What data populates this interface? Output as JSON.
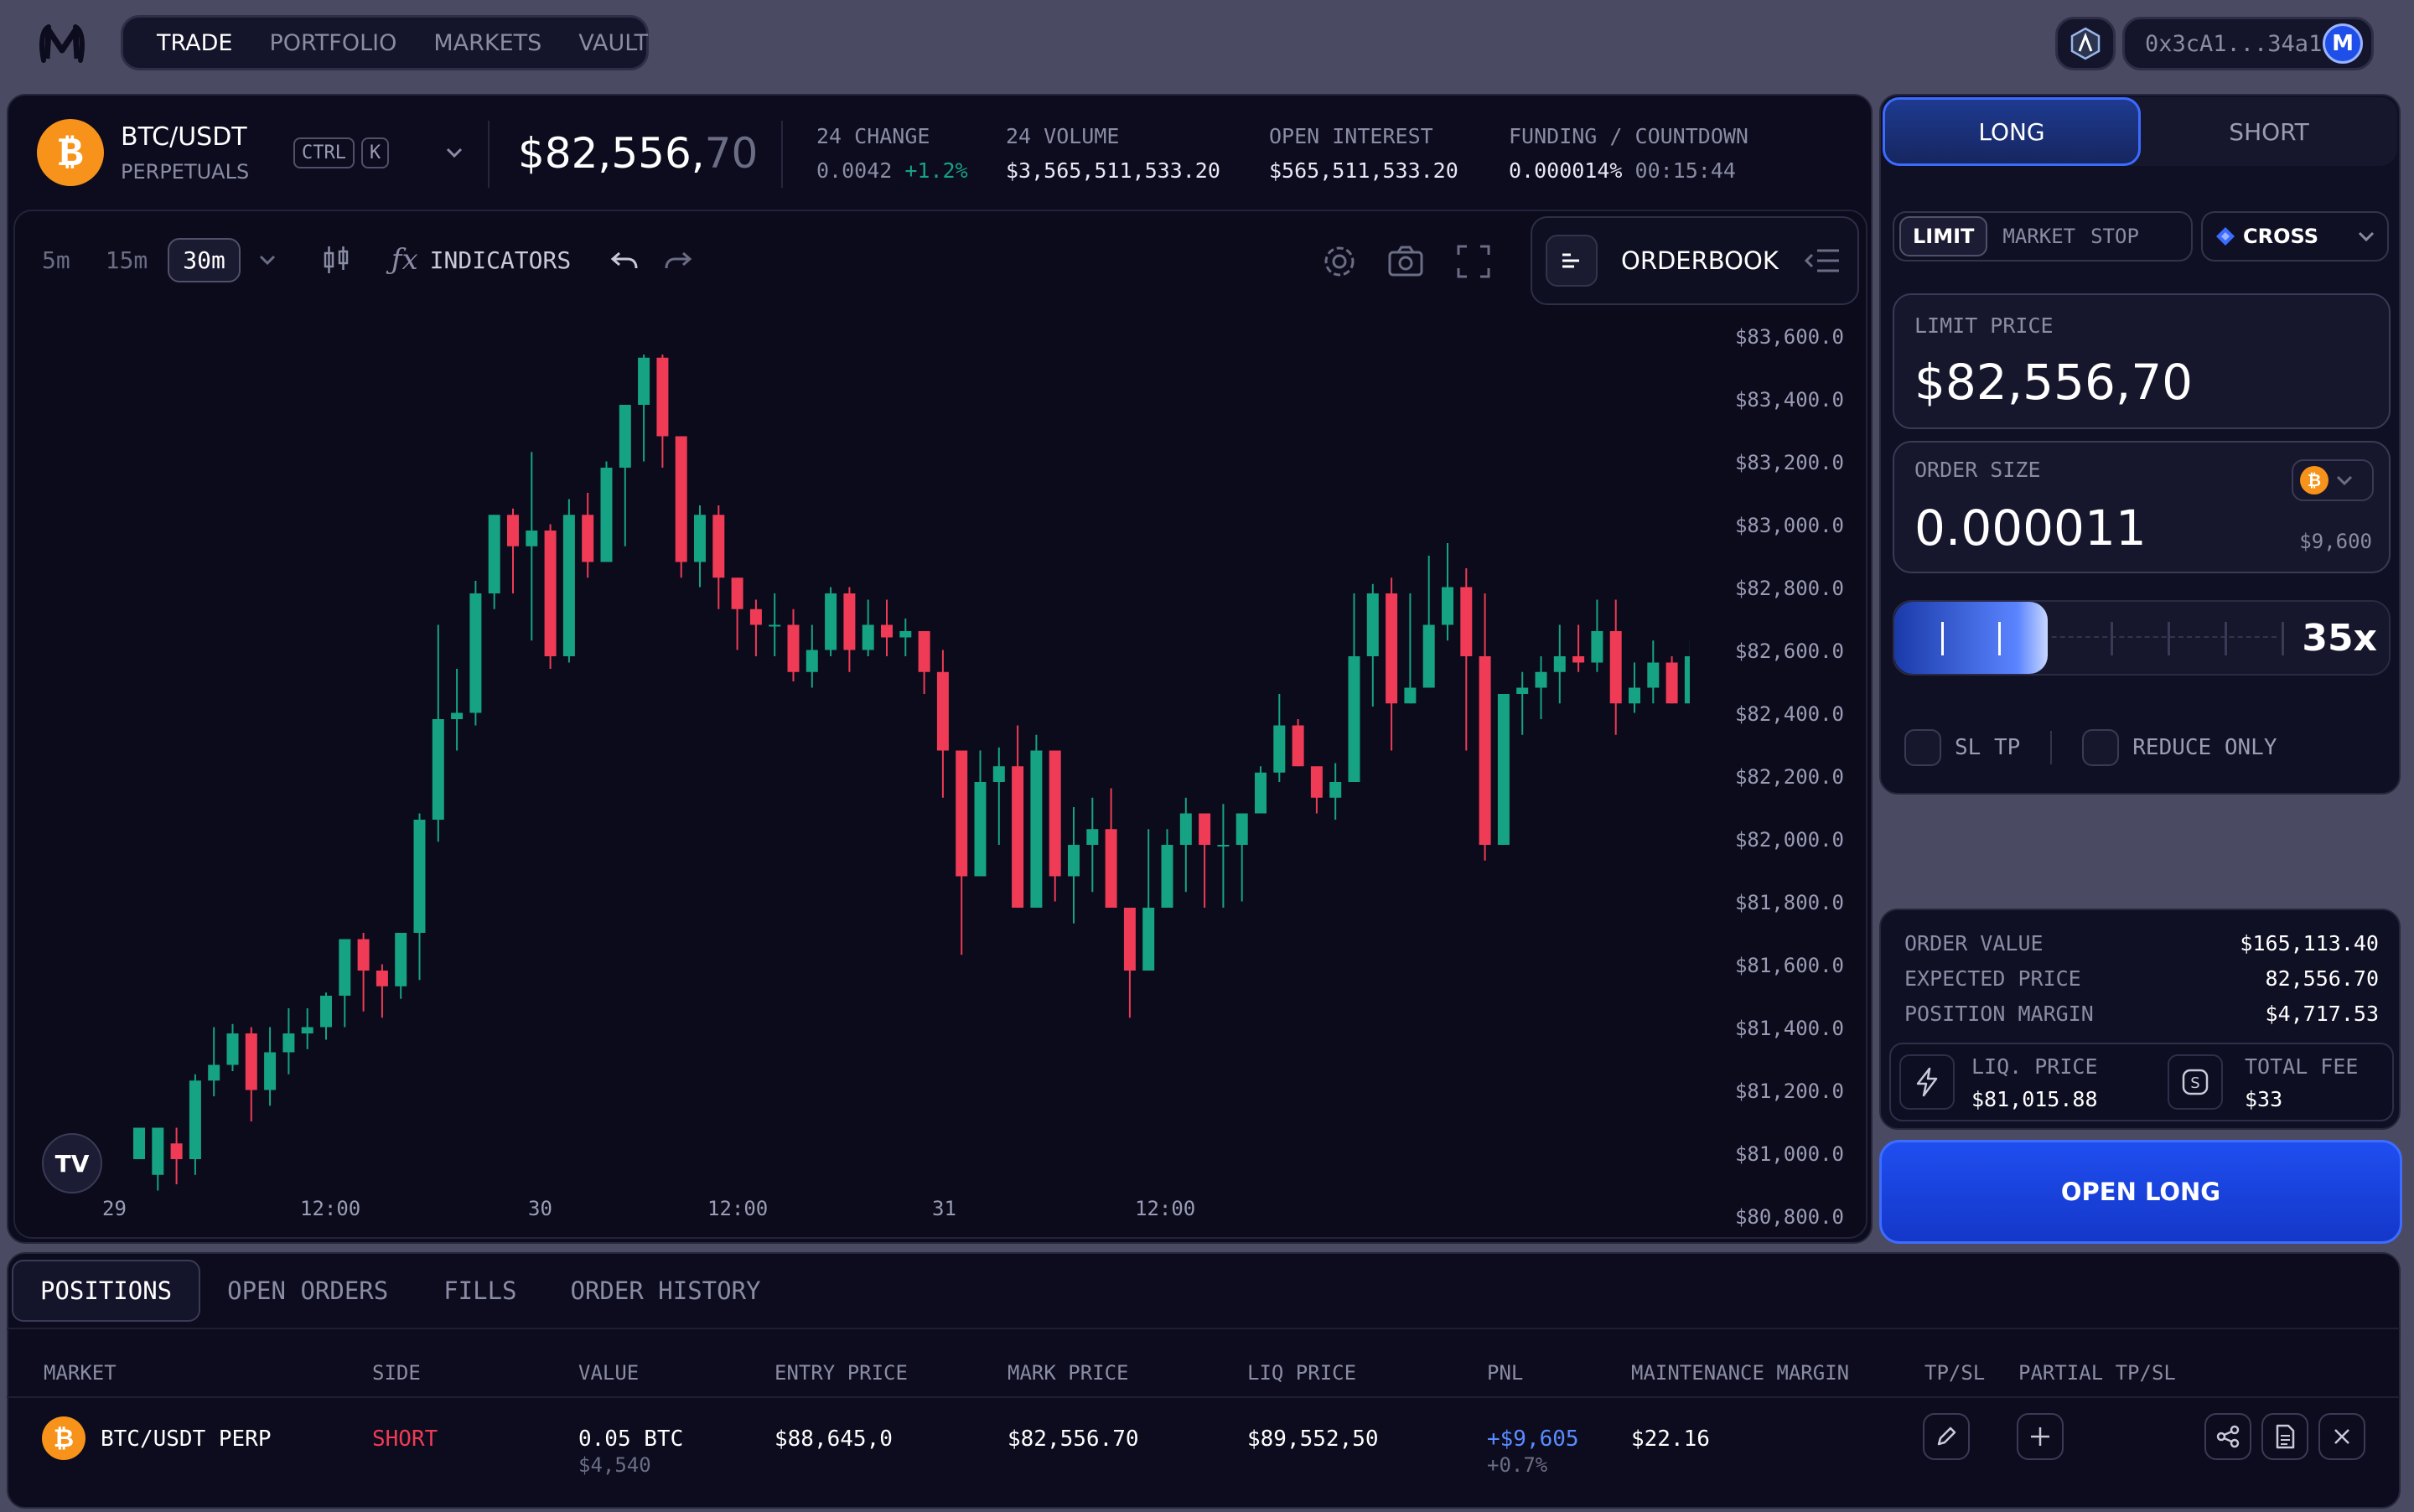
{
  "nav": {
    "tabs": [
      "TRADE",
      "PORTFOLIO",
      "MARKETS",
      "VAULT"
    ],
    "active_tab": "TRADE",
    "wallet_address": "0x3cA1...34a1"
  },
  "market": {
    "symbol": "BTC/USDT",
    "type": "PERPETUALS",
    "shortcut_keys": [
      "CTRL",
      "K"
    ],
    "price_main": "$82,556,",
    "price_decimals": "70",
    "stats": [
      {
        "label": "24 CHANGE",
        "value": "0.0042",
        "extra": "+1.2%"
      },
      {
        "label": "24 VOLUME",
        "value": "$3,565,511,533.20",
        "extra": ""
      },
      {
        "label": "OPEN INTEREST",
        "value": "$565,511,533.20",
        "extra": ""
      },
      {
        "label": "FUNDING / COUNTDOWN",
        "value": "0.000014%",
        "extra": "00:15:44"
      }
    ]
  },
  "chart_toolbar": {
    "timeframes": [
      "5m",
      "15m",
      "30m"
    ],
    "active_timeframe": "30m",
    "indicators_label": "INDICATORS",
    "orderbook_label": "ORDERBOOK"
  },
  "chart_data": {
    "type": "candlestick",
    "y_ticks": [
      "$83,600.0",
      "$83,400.0",
      "$83,200.0",
      "$83,000.0",
      "$82,800.0",
      "$82,600.0",
      "$82,400.0",
      "$82,200.0",
      "$82,000.0",
      "$81,800.0",
      "$81,600.0",
      "$81,400.0",
      "$81,200.0",
      "$81,000.0",
      "$80,800.0"
    ],
    "x_ticks": [
      "29",
      "12:00",
      "30",
      "12:00",
      "31",
      "12:00"
    ],
    "ylim": [
      80800,
      83600
    ],
    "colors": {
      "up": "#16a383",
      "down": "#ef3b55"
    },
    "candles": [
      [
        81000,
        81100,
        80950,
        80950
      ],
      [
        80950,
        81100,
        80900,
        81050
      ],
      [
        81050,
        81000,
        80920,
        81100
      ],
      [
        81000,
        81250,
        80950,
        81270
      ],
      [
        81250,
        81300,
        81200,
        81420
      ],
      [
        81300,
        81400,
        81280,
        81430
      ],
      [
        81400,
        81220,
        81120,
        81420
      ],
      [
        81220,
        81340,
        81170,
        81420
      ],
      [
        81340,
        81400,
        81270,
        81480
      ],
      [
        81400,
        81420,
        81350,
        81480
      ],
      [
        81420,
        81520,
        81380,
        81530
      ],
      [
        81520,
        81700,
        81420,
        81700
      ],
      [
        81700,
        81600,
        81470,
        81720
      ],
      [
        81600,
        81550,
        81450,
        81620
      ],
      [
        81550,
        81720,
        81510,
        81720
      ],
      [
        81720,
        82080,
        81570,
        82100
      ],
      [
        82080,
        82400,
        82010,
        82700
      ],
      [
        82400,
        82420,
        82300,
        82560
      ],
      [
        82420,
        82800,
        82380,
        82840
      ],
      [
        82800,
        83050,
        82750,
        83050
      ],
      [
        83050,
        82950,
        82800,
        83070
      ],
      [
        82950,
        83000,
        82650,
        83250
      ],
      [
        83000,
        82600,
        82560,
        83020
      ],
      [
        82600,
        83050,
        82580,
        83100
      ],
      [
        83050,
        82900,
        82850,
        83120
      ],
      [
        82900,
        83200,
        82900,
        83220
      ],
      [
        83200,
        83400,
        82950,
        83400
      ],
      [
        83400,
        83550,
        83220,
        83560
      ],
      [
        83550,
        83300,
        83200,
        83560
      ],
      [
        83300,
        82900,
        82850,
        83200
      ],
      [
        82900,
        83050,
        82820,
        83080
      ],
      [
        83050,
        82850,
        82750,
        83080
      ],
      [
        82850,
        82750,
        82620,
        82850
      ],
      [
        82750,
        82700,
        82600,
        82780
      ],
      [
        82700,
        82700,
        82600,
        82800
      ],
      [
        82700,
        82550,
        82520,
        82750
      ],
      [
        82550,
        82620,
        82500,
        82700
      ],
      [
        82620,
        82800,
        82600,
        82820
      ],
      [
        82800,
        82620,
        82550,
        82820
      ],
      [
        82620,
        82700,
        82600,
        82780
      ],
      [
        82700,
        82660,
        82600,
        82780
      ],
      [
        82660,
        82680,
        82600,
        82720
      ],
      [
        82680,
        82550,
        82480,
        82660
      ],
      [
        82550,
        82300,
        82150,
        82620
      ],
      [
        82300,
        81900,
        81650,
        82300
      ],
      [
        81900,
        82200,
        81900,
        82300
      ],
      [
        82200,
        82250,
        82000,
        82310
      ],
      [
        82250,
        81800,
        81800,
        82380
      ],
      [
        81800,
        82300,
        81880,
        82350
      ],
      [
        82300,
        81900,
        81820,
        82300
      ],
      [
        81900,
        82000,
        81750,
        82120
      ],
      [
        82000,
        82050,
        81850,
        82150
      ],
      [
        82050,
        81800,
        81800,
        82180
      ],
      [
        81800,
        81600,
        81450,
        81800
      ],
      [
        81600,
        81800,
        81750,
        82050
      ],
      [
        81800,
        82000,
        81800,
        82050
      ],
      [
        82000,
        82100,
        81850,
        82150
      ],
      [
        82100,
        82000,
        81800,
        82100
      ],
      [
        82000,
        82000,
        81800,
        82130
      ],
      [
        82000,
        82100,
        81820,
        82100
      ],
      [
        82100,
        82230,
        82100,
        82250
      ],
      [
        82230,
        82380,
        82200,
        82480
      ],
      [
        82380,
        82250,
        82250,
        82400
      ],
      [
        82250,
        82150,
        82100,
        82220
      ],
      [
        82150,
        82200,
        82080,
        82260
      ],
      [
        82200,
        82600,
        82200,
        82800
      ],
      [
        82600,
        82800,
        82440,
        82830
      ],
      [
        82800,
        82450,
        82300,
        82850
      ],
      [
        82450,
        82500,
        82450,
        82800
      ],
      [
        82500,
        82700,
        82650,
        82920
      ],
      [
        82700,
        82820,
        82650,
        82960
      ],
      [
        82820,
        82600,
        82300,
        82880
      ],
      [
        82600,
        82000,
        81950,
        82800
      ],
      [
        82000,
        82480,
        82000,
        82480
      ],
      [
        82480,
        82500,
        82350,
        82550
      ],
      [
        82500,
        82550,
        82400,
        82600
      ],
      [
        82550,
        82600,
        82450,
        82700
      ],
      [
        82600,
        82580,
        82550,
        82700
      ],
      [
        82580,
        82680,
        82550,
        82780
      ],
      [
        82680,
        82450,
        82350,
        82780
      ],
      [
        82450,
        82500,
        82420,
        82580
      ],
      [
        82500,
        82580,
        82450,
        82650
      ],
      [
        82580,
        82450,
        82450,
        82600
      ],
      [
        82450,
        82600,
        82440,
        82650
      ],
      [
        82600,
        82650,
        82560,
        82700
      ],
      [
        82650,
        82700,
        82500,
        82960
      ],
      [
        82700,
        82800,
        82650,
        82850
      ],
      [
        82800,
        82700,
        82620,
        82830
      ],
      [
        82700,
        82650,
        82600,
        82720
      ],
      [
        82650,
        82560,
        82500,
        82700
      ],
      [
        82560,
        82720,
        82500,
        82740
      ],
      [
        82720,
        82760,
        82680,
        82800
      ],
      [
        82760,
        83080,
        82760,
        83150
      ]
    ]
  },
  "order_panel": {
    "side_tabs": [
      "LONG",
      "SHORT"
    ],
    "active_side": "LONG",
    "order_types": [
      "LIMIT",
      "MARKET",
      "STOP"
    ],
    "active_order_type": "LIMIT",
    "margin_mode": "CROSS",
    "limit_price_label": "LIMIT PRICE",
    "limit_price_value": "$82,556,70",
    "order_size_label": "ORDER SIZE",
    "order_size_value": "0.000011",
    "order_size_usd": "$9,600",
    "leverage": "35x",
    "leverage_fraction": 0.31,
    "sl_tp_label": "SL TP",
    "reduce_only_label": "REDUCE ONLY",
    "summary": [
      {
        "label": "ORDER VALUE",
        "value": "$165,113.40"
      },
      {
        "label": "EXPECTED PRICE",
        "value": "82,556.70"
      },
      {
        "label": "POSITION MARGIN",
        "value": "$4,717.53"
      }
    ],
    "liq_price_label": "LIQ. PRICE",
    "liq_price_value": "$81,015.88",
    "total_fee_label": "TOTAL FEE",
    "total_fee_value": "$33",
    "submit_label": "OPEN LONG"
  },
  "positions": {
    "tabs": [
      "POSITIONS",
      "OPEN ORDERS",
      "FILLS",
      "ORDER HISTORY"
    ],
    "active_tab": "POSITIONS",
    "columns": [
      "MARKET",
      "SIDE",
      "VALUE",
      "ENTRY PRICE",
      "MARK PRICE",
      "LIQ PRICE",
      "PNL",
      "MAINTENANCE MARGIN",
      "TP/SL",
      "PARTIAL TP/SL"
    ],
    "rows": [
      {
        "market": "BTC/USDT PERP",
        "side": "SHORT",
        "value": "0.05 BTC",
        "value_usd": "$4,540",
        "entry_price": "$88,645,0",
        "mark_price": "$82,556.70",
        "liq_price": "$89,552,50",
        "pnl": "+$9,605",
        "pnl_pct": "+0.7%",
        "maintenance_margin": "$22.16"
      }
    ]
  },
  "colors": {
    "accent_blue": "#1746e6",
    "up_green": "#16a383",
    "down_red": "#ef3b55",
    "bitcoin_orange": "#f7931a",
    "background": "#0c0c1e"
  }
}
